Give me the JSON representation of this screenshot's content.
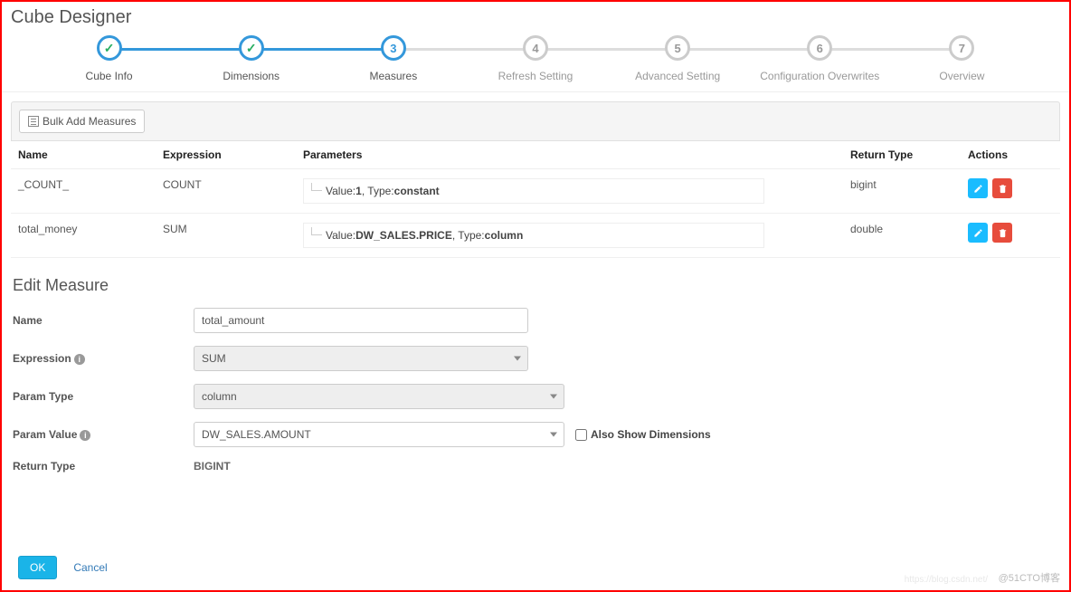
{
  "header": {
    "title": "Cube Designer"
  },
  "steps": [
    {
      "label": "Cube Info"
    },
    {
      "label": "Dimensions"
    },
    {
      "num": "3",
      "label": "Measures"
    },
    {
      "num": "4",
      "label": "Refresh Setting"
    },
    {
      "num": "5",
      "label": "Advanced Setting"
    },
    {
      "num": "6",
      "label": "Configuration Overwrites"
    },
    {
      "num": "7",
      "label": "Overview"
    }
  ],
  "toolbar": {
    "bulk_add": "Bulk Add Measures"
  },
  "table": {
    "cols": {
      "name": "Name",
      "expression": "Expression",
      "parameters": "Parameters",
      "return": "Return Type",
      "actions": "Actions"
    },
    "rows": [
      {
        "name": "_COUNT_",
        "expr": "COUNT",
        "param_prefix": "Value:",
        "param_value": "1",
        "param_mid": ", Type:",
        "param_type": "constant",
        "ret": "bigint"
      },
      {
        "name": "total_money",
        "expr": "SUM",
        "param_prefix": "Value:",
        "param_value": "DW_SALES.PRICE",
        "param_mid": ", Type:",
        "param_type": "column",
        "ret": "double"
      }
    ]
  },
  "edit": {
    "title": "Edit Measure",
    "name_label": "Name",
    "name_value": "total_amount",
    "expr_label": "Expression",
    "expr_value": "SUM",
    "ptype_label": "Param Type",
    "ptype_value": "column",
    "pval_label": "Param Value",
    "pval_value": "DW_SALES.AMOUNT",
    "also_show": "Also Show Dimensions",
    "ret_label": "Return Type",
    "ret_value": "BIGINT"
  },
  "footer": {
    "ok": "OK",
    "cancel": "Cancel"
  },
  "watermark": "@51CTO博客",
  "watermark2": "https://blog.csdn.net/"
}
